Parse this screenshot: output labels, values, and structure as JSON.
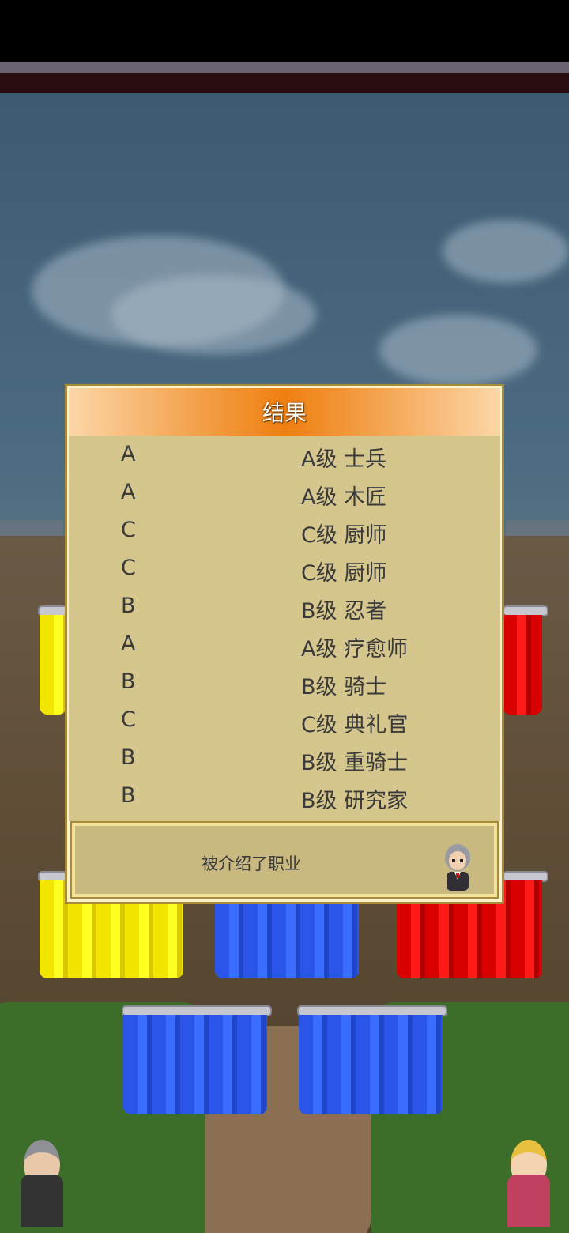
{
  "dialog": {
    "title": "结果",
    "rows": [
      {
        "rank": "A",
        "job": "A级 士兵"
      },
      {
        "rank": "A",
        "job": "A级 木匠"
      },
      {
        "rank": "C",
        "job": "C级 厨师"
      },
      {
        "rank": "C",
        "job": "C级 厨师"
      },
      {
        "rank": "B",
        "job": "B级 忍者"
      },
      {
        "rank": "A",
        "job": "A级 疗愈师"
      },
      {
        "rank": "B",
        "job": "B级 骑士"
      },
      {
        "rank": "C",
        "job": "C级 典礼官"
      },
      {
        "rank": "B",
        "job": "B级 重骑士"
      },
      {
        "rank": "B",
        "job": "B级 研究家"
      }
    ],
    "message": "被介绍了职业"
  },
  "colors": {
    "header_orange": "#f07f10",
    "panel_bg": "#d4c68d",
    "curtain_yellow": "#f2e600",
    "curtain_blue": "#2a55e8",
    "curtain_red": "#d80000"
  },
  "icons": [
    "butler-avatar-icon",
    "girl-avatar-icon"
  ]
}
